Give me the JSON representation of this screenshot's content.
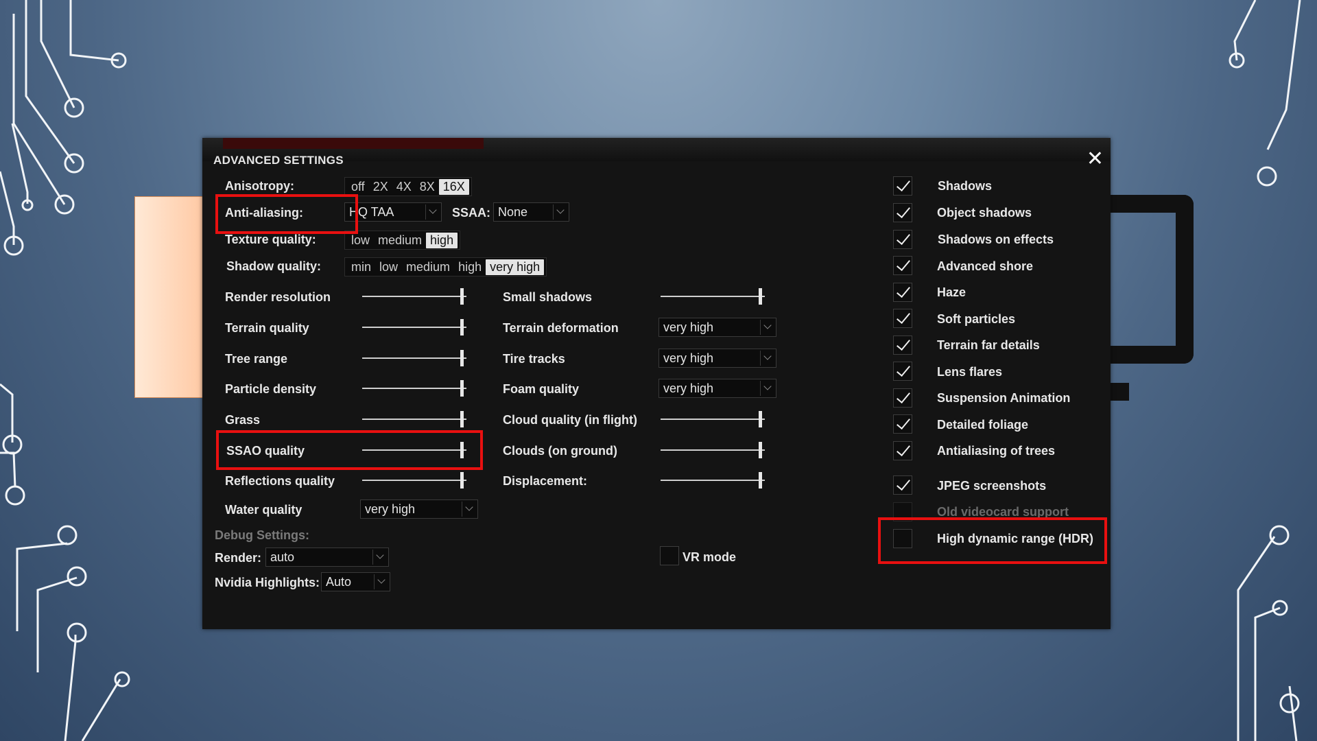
{
  "window": {
    "title": "ADVANCED SETTINGS"
  },
  "anisotropy": {
    "label": "Anisotropy:",
    "options": [
      "off",
      "2X",
      "4X",
      "8X",
      "16X"
    ],
    "selected": "16X"
  },
  "anti_aliasing": {
    "label": "Anti-aliasing:",
    "value": "HQ TAA"
  },
  "ssaa": {
    "label": "SSAA:",
    "value": "None"
  },
  "texture_quality": {
    "label": "Texture quality:",
    "options": [
      "low",
      "medium",
      "high"
    ],
    "selected": "high"
  },
  "shadow_quality": {
    "label": "Shadow quality:",
    "options": [
      "min",
      "low",
      "medium",
      "high",
      "very high"
    ],
    "selected": "very high"
  },
  "sliders_left": [
    {
      "label": "Render resolution",
      "level": 1.0
    },
    {
      "label": "Terrain quality",
      "level": 1.0
    },
    {
      "label": "Tree range",
      "level": 1.0
    },
    {
      "label": "Particle density",
      "level": 1.0
    },
    {
      "label": "Grass",
      "level": 1.0
    },
    {
      "label": "SSAO quality",
      "level": 1.0
    },
    {
      "label": "Reflections quality",
      "level": 1.0
    }
  ],
  "water_quality": {
    "label": "Water quality",
    "value": "very high"
  },
  "middle": {
    "small_shadows": {
      "label": "Small shadows",
      "level": 1.0
    },
    "terrain_deformation": {
      "label": "Terrain deformation",
      "value": "very high"
    },
    "tire_tracks": {
      "label": "Tire tracks",
      "value": "very high"
    },
    "foam_quality": {
      "label": "Foam quality",
      "value": "very high"
    },
    "cloud_quality": {
      "label": "Cloud quality (in flight)",
      "level": 1.0
    },
    "clouds_ground": {
      "label": "Clouds (on ground)",
      "level": 1.0
    },
    "displacement": {
      "label": "Displacement:",
      "level": 1.0
    }
  },
  "debug": {
    "heading": "Debug Settings:",
    "render": {
      "label": "Render:",
      "value": "auto"
    },
    "nvidia": {
      "label": "Nvidia Highlights:",
      "value": "Auto"
    }
  },
  "vr_mode": {
    "label": "VR mode",
    "checked": false
  },
  "checkboxes": [
    {
      "label": "Shadows",
      "checked": true
    },
    {
      "label": "Object shadows",
      "checked": true
    },
    {
      "label": "Shadows on effects",
      "checked": true
    },
    {
      "label": "Advanced shore",
      "checked": true
    },
    {
      "label": "Haze",
      "checked": true
    },
    {
      "label": "Soft particles",
      "checked": true
    },
    {
      "label": "Terrain far details",
      "checked": true
    },
    {
      "label": "Lens flares",
      "checked": true
    },
    {
      "label": "Suspension Animation",
      "checked": true
    },
    {
      "label": "Detailed foliage",
      "checked": true
    },
    {
      "label": "Antialiasing of trees",
      "checked": true
    },
    {
      "label": "JPEG screenshots",
      "checked": true
    },
    {
      "label": "Old videocard support",
      "checked": false
    },
    {
      "label": "High dynamic range (HDR)",
      "checked": false
    }
  ],
  "colors": {
    "highlight": "#e81010",
    "panel": "#141414",
    "accent_tab": "#3a0a0a"
  }
}
